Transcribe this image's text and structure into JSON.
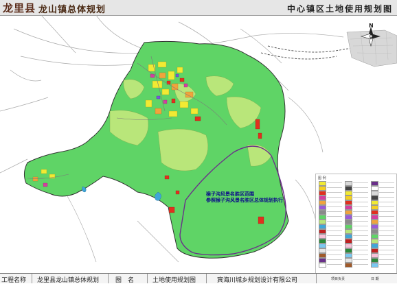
{
  "header": {
    "county": "龙里县",
    "project": "龙山镇总体规划",
    "sheet_title": "中心镇区土地使用规划图"
  },
  "map": {
    "north_label": "N",
    "colors": {
      "background": "#ffffff",
      "base_green": "#5fd466",
      "light_green": "#b9e67a",
      "yellow": "#f1ea33",
      "orange": "#f0a43c",
      "red": "#e1301e",
      "magenta": "#d43ea0",
      "purple_boundary": "#6a2f8a",
      "road": "#a9a9a9"
    },
    "annotation": [
      "猴子沟风景名胜区范围",
      "参照猴子沟风景名胜区总体规划执行"
    ]
  },
  "legend": {
    "title": "图 例"
  },
  "title_block": {
    "project_label": "工程名称",
    "project_value": "龙里县龙山镇总体规划",
    "drawing_label": "图　名",
    "drawing_value": "土地使用规划图",
    "company": "宾海川城乡规划设计有限公司",
    "field_a": "项目负责",
    "field_b": "日 期"
  }
}
